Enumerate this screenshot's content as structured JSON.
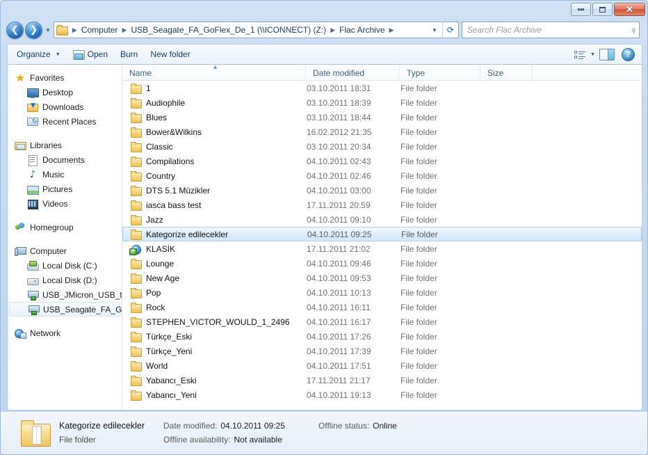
{
  "window": {
    "controls": {
      "minimize": "Minimize",
      "maximize": "Maximize",
      "close": "✕"
    }
  },
  "address": {
    "back_label": "Back",
    "forward_label": "Forward",
    "history_label": "Recent pages",
    "crumbs": [
      "Computer",
      "USB_Seagate_FA_GoFlex_De_1 (\\\\ICONNECT) (Z:)",
      "Flac Archive"
    ],
    "separator": "▶",
    "dropdown": "▼",
    "refresh": "⟳"
  },
  "search": {
    "placeholder": "Search Flac Archive",
    "icon": "search-icon",
    "glyph": "⌕"
  },
  "toolbar": {
    "organize": "Organize",
    "open": "Open",
    "burn": "Burn",
    "new_folder": "New folder",
    "caret": "▼",
    "view_label": "Change your view",
    "preview_label": "Show the preview pane",
    "help_label": "?"
  },
  "sidebar": {
    "groups": [
      {
        "header": {
          "label": "Favorites",
          "icon": "star-icon"
        },
        "items": [
          {
            "label": "Desktop",
            "icon": "desktop-icon"
          },
          {
            "label": "Downloads",
            "icon": "downloads-icon"
          },
          {
            "label": "Recent Places",
            "icon": "recent-places-icon"
          }
        ]
      },
      {
        "header": {
          "label": "Libraries",
          "icon": "libraries-icon"
        },
        "items": [
          {
            "label": "Documents",
            "icon": "documents-icon"
          },
          {
            "label": "Music",
            "icon": "music-icon"
          },
          {
            "label": "Pictures",
            "icon": "pictures-icon"
          },
          {
            "label": "Videos",
            "icon": "videos-icon"
          }
        ]
      },
      {
        "header": {
          "label": "Homegroup",
          "icon": "homegroup-icon"
        },
        "items": []
      },
      {
        "header": {
          "label": "Computer",
          "icon": "computer-icon"
        },
        "items": [
          {
            "label": "Local Disk (C:)",
            "icon": "system-drive-icon"
          },
          {
            "label": "Local Disk (D:)",
            "icon": "drive-icon"
          },
          {
            "label": "USB_JMicron_USB_to",
            "icon": "network-drive-icon"
          },
          {
            "label": "USB_Seagate_FA_Go",
            "icon": "network-drive-icon",
            "selected": true
          }
        ]
      },
      {
        "header": {
          "label": "Network",
          "icon": "network-icon"
        },
        "items": []
      }
    ]
  },
  "columns": [
    {
      "key": "name",
      "label": "Name",
      "sorted": true,
      "sort_glyph": "▲"
    },
    {
      "key": "date",
      "label": "Date modified"
    },
    {
      "key": "type",
      "label": "Type"
    },
    {
      "key": "size",
      "label": "Size"
    }
  ],
  "files": [
    {
      "name": "1",
      "date": "03.10.2011 18:31",
      "type": "File folder",
      "size": "",
      "icon": "folder-icon"
    },
    {
      "name": "Audiophile",
      "date": "03.10.2011 18:39",
      "type": "File folder",
      "size": "",
      "icon": "folder-icon"
    },
    {
      "name": "Blues",
      "date": "03.10.2011 18:44",
      "type": "File folder",
      "size": "",
      "icon": "folder-icon"
    },
    {
      "name": "Bower&Wilkins",
      "date": "16.02.2012 21:35",
      "type": "File folder",
      "size": "",
      "icon": "folder-icon"
    },
    {
      "name": "Classic",
      "date": "03.10.2011 20:34",
      "type": "File folder",
      "size": "",
      "icon": "folder-icon"
    },
    {
      "name": "Compilations",
      "date": "04.10.2011 02:43",
      "type": "File folder",
      "size": "",
      "icon": "folder-icon"
    },
    {
      "name": "Country",
      "date": "04.10.2011 02:46",
      "type": "File folder",
      "size": "",
      "icon": "folder-icon"
    },
    {
      "name": "DTS 5.1 Müzikler",
      "date": "04.10.2011 03:00",
      "type": "File folder",
      "size": "",
      "icon": "folder-icon"
    },
    {
      "name": "iasca bass test",
      "date": "17.11.2011 20:59",
      "type": "File folder",
      "size": "",
      "icon": "folder-icon"
    },
    {
      "name": "Jazz",
      "date": "04.10.2011 09:10",
      "type": "File folder",
      "size": "",
      "icon": "folder-icon"
    },
    {
      "name": "Kategorize edilecekler",
      "date": "04.10.2011 09:25",
      "type": "File folder",
      "size": "",
      "icon": "folder-icon",
      "selected": true
    },
    {
      "name": "KLASİK",
      "date": "17.11.2011 21:02",
      "type": "File folder",
      "size": "",
      "icon": "shared-folder-icon"
    },
    {
      "name": "Lounge",
      "date": "04.10.2011 09:46",
      "type": "File folder",
      "size": "",
      "icon": "folder-icon"
    },
    {
      "name": "New Age",
      "date": "04.10.2011 09:53",
      "type": "File folder",
      "size": "",
      "icon": "folder-icon"
    },
    {
      "name": "Pop",
      "date": "04.10.2011 10:13",
      "type": "File folder",
      "size": "",
      "icon": "folder-icon"
    },
    {
      "name": "Rock",
      "date": "04.10.2011 16:11",
      "type": "File folder",
      "size": "",
      "icon": "folder-icon"
    },
    {
      "name": "STEPHEN_VICTOR_WOULD_1_2496",
      "date": "04.10.2011 16:17",
      "type": "File folder",
      "size": "",
      "icon": "folder-icon"
    },
    {
      "name": "Türkçe_Eski",
      "date": "04.10.2011 17:26",
      "type": "File folder",
      "size": "",
      "icon": "folder-icon"
    },
    {
      "name": "Türkçe_Yeni",
      "date": "04.10.2011 17:39",
      "type": "File folder",
      "size": "",
      "icon": "folder-icon"
    },
    {
      "name": "World",
      "date": "04.10.2011 17:51",
      "type": "File folder",
      "size": "",
      "icon": "folder-icon"
    },
    {
      "name": "Yabancı_Eski",
      "date": "17.11.2011 21:17",
      "type": "File folder",
      "size": "",
      "icon": "folder-icon"
    },
    {
      "name": "Yabancı_Yeni",
      "date": "04.10.2011 19:13",
      "type": "File folder",
      "size": "",
      "icon": "folder-icon"
    }
  ],
  "details": {
    "title": "Kategorize edilecekler",
    "subtitle": "File folder",
    "date_label": "Date modified:",
    "date_value": "04.10.2011 09:25",
    "availability_label": "Offline availability:",
    "availability_value": "Not available",
    "offline_label": "Offline status:",
    "offline_value": "Online"
  },
  "colors": {
    "accent": "#2c7fbd",
    "selection": "#d3e7f8",
    "selection_border": "#a9d0ee",
    "folder": "#f8d880",
    "frame": "#c5d9ee",
    "close_button": "#cf5437"
  }
}
